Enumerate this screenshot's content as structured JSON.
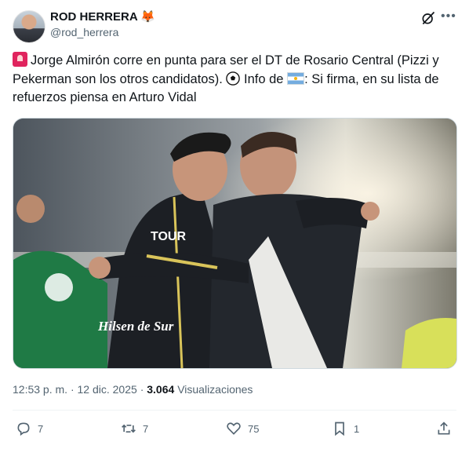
{
  "header": {
    "display_name": "ROD HERRERA",
    "name_emoji": "🦊",
    "handle": "@rod_herrera"
  },
  "post": {
    "text_parts": [
      "Jorge Almirón corre en punta para ser el DT de Rosario Central (Pizzi y Pekerman son los otros candidatos).",
      "Info de",
      ": Si firma, en su lista de refuerzos piensa en Arturo Vidal"
    ],
    "image_shirt_text": "Hilsen de Sur"
  },
  "meta": {
    "time": "12:53 p. m.",
    "separator": "·",
    "date": "12 dic. 2025",
    "views_count": "3.064",
    "views_label": "Visualizaciones"
  },
  "actions": {
    "replies": "7",
    "reposts": "7",
    "likes": "75",
    "bookmarks": "1"
  },
  "icons": [
    "siren-icon",
    "soccer-ball-icon",
    "argentina-flag-icon",
    "grok-icon",
    "more-icon",
    "reply-icon",
    "repost-icon",
    "like-icon",
    "bookmark-icon",
    "share-icon"
  ],
  "colors": {
    "text": "#0f1419",
    "secondary": "#536471",
    "border": "#cfd9de"
  }
}
